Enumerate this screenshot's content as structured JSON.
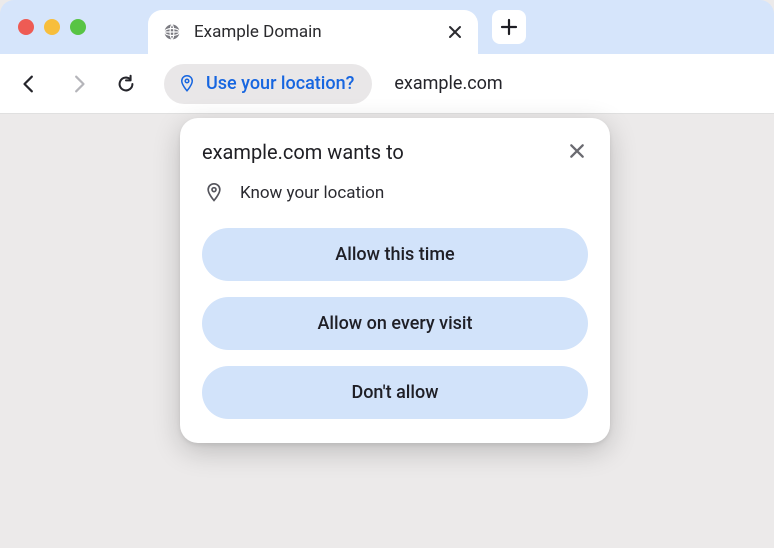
{
  "tab": {
    "title": "Example Domain"
  },
  "omnibox": {
    "chip_label": "Use your location?",
    "url": "example.com"
  },
  "permission_popup": {
    "title": "example.com wants to",
    "permission_label": "Know your location",
    "buttons": {
      "allow_once": "Allow this time",
      "allow_always": "Allow on every visit",
      "deny": "Don't allow"
    }
  }
}
